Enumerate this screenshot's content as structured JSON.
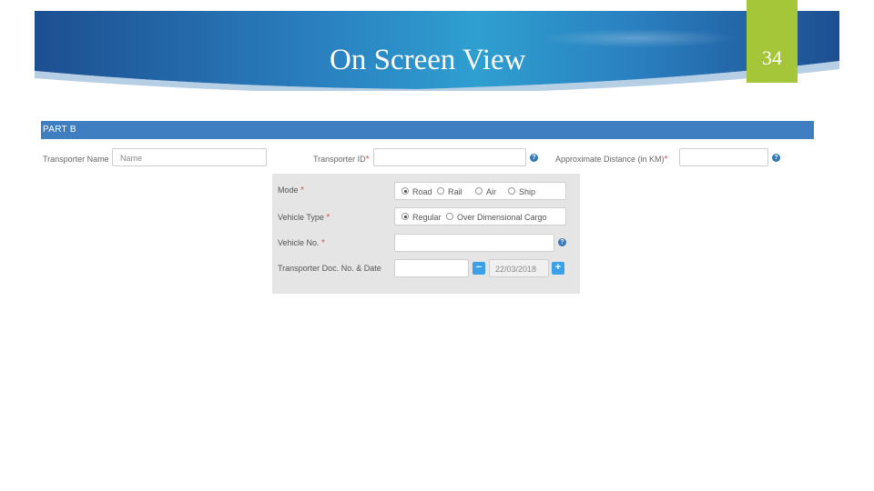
{
  "slide": {
    "title": "On Screen View",
    "number": "34"
  },
  "form": {
    "section_title": "PART B",
    "transporter_name": {
      "label": "Transporter Name",
      "placeholder": "Name"
    },
    "transporter_id": {
      "label": "Transporter ID",
      "required": "*",
      "help": "?"
    },
    "distance": {
      "label": "Approximate Distance (in KM)",
      "required": "*",
      "help": "?"
    },
    "mode": {
      "label": "Mode",
      "required": "*",
      "options": [
        "Road",
        "Rail",
        "Air",
        "Ship"
      ],
      "selected": "Road"
    },
    "vehicle_type": {
      "label": "Vehicle Type",
      "required": "*",
      "options": [
        "Regular",
        "Over Dimensional Cargo"
      ],
      "selected": "Regular"
    },
    "vehicle_no": {
      "label": "Vehicle No.",
      "required": "*",
      "help": "?"
    },
    "transporter_doc": {
      "label": "Transporter Doc. No. & Date",
      "minus": "−",
      "plus": "+",
      "date_value": "22/03/2018"
    }
  },
  "colors": {
    "header_blue": "#3f7fc1",
    "slide_accent": "#a6c63a",
    "banner_dark": "#1d4f91",
    "banner_light": "#2f9fd0"
  }
}
